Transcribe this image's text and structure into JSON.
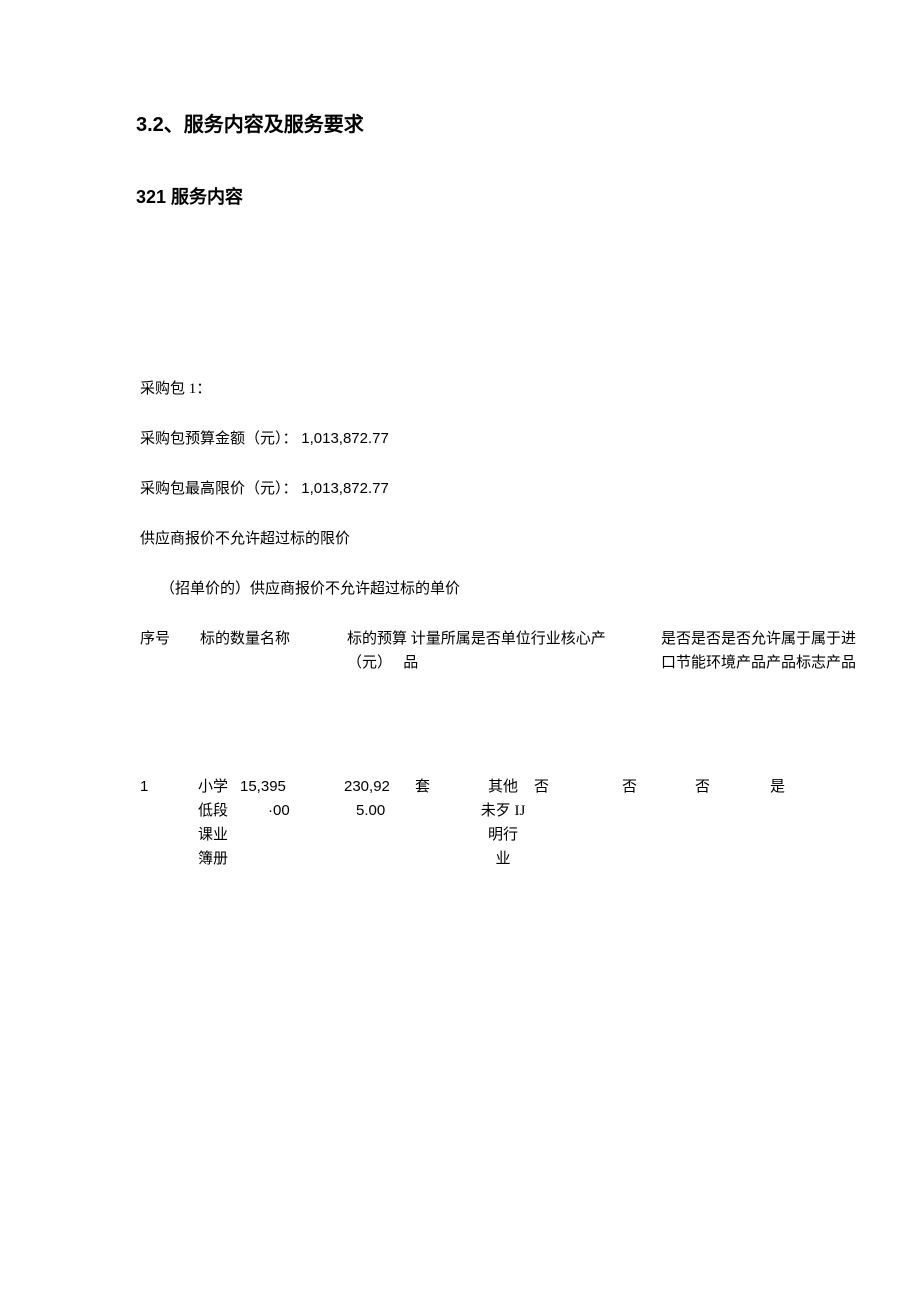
{
  "section": {
    "heading": "3.2、服务内容及服务要求",
    "sub_heading": "321 服务内容"
  },
  "package": {
    "title": "采购包 1：",
    "budget_label": "采购包预算金额（元）：",
    "budget_value": "1,013,872.77",
    "ceiling_label": "采购包最高限价（元）：",
    "ceiling_value": "1,013,872.77",
    "note1": "供应商报价不允许超过标的限价",
    "note2": "（招单价的）供应商报价不允许超过标的单价"
  },
  "table": {
    "headers": {
      "c1": "序号",
      "c2": "标的数量名称",
      "c3_line1": "标的预算 计量所属是否单位行业核心产",
      "c3_line2": "（元）   品",
      "c4_line1": "是否是否是否允许属于属于进",
      "c4_line2": "口节能环境产品产品标志产品"
    },
    "rows": [
      {
        "seq": "1",
        "name_l1": "小学",
        "name_l2": "低段",
        "name_l3": "课业",
        "name_l4": "簿册",
        "qty_main": "15,395",
        "qty_suffix": "·00",
        "budget_l1": "230,92",
        "budget_l2": "5.00",
        "unit": "套",
        "industry_l1": "其他",
        "industry_l2": "未歹 IJ",
        "industry_l3": "明行",
        "industry_l4": "业",
        "core": "否",
        "import": "否",
        "energy": "否",
        "eco": "是"
      }
    ]
  }
}
